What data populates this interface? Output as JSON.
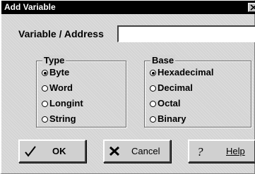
{
  "window": {
    "title": "Add Variable",
    "close_icon": "close-icon"
  },
  "variable": {
    "label": "Variable / Address",
    "value": ""
  },
  "type_group": {
    "legend": "Type",
    "options": [
      {
        "label": "Byte",
        "checked": true
      },
      {
        "label": "Word",
        "checked": false
      },
      {
        "label": "Longint",
        "checked": false
      },
      {
        "label": "String",
        "checked": false
      }
    ]
  },
  "base_group": {
    "legend": "Base",
    "options": [
      {
        "label": "Hexadecimal",
        "checked": true
      },
      {
        "label": "Decimal",
        "checked": false
      },
      {
        "label": "Octal",
        "checked": false
      },
      {
        "label": "Binary",
        "checked": false
      }
    ]
  },
  "buttons": {
    "ok": {
      "label": "OK",
      "icon": "checkmark-icon"
    },
    "cancel": {
      "label": "Cancel",
      "icon": "x-icon"
    },
    "help": {
      "label": "Help",
      "icon": "question-mark-icon"
    }
  },
  "colors": {
    "titlebar": "#000000",
    "dialog_bg": "#d4d4d4"
  }
}
